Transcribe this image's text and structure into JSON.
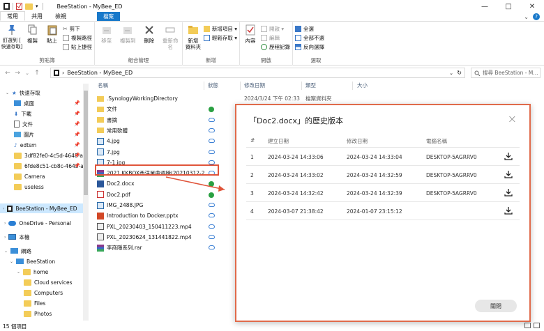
{
  "window": {
    "title": "BeeStation - MyBee_ED",
    "minimize": "—",
    "maximize": "□",
    "close": "✕"
  },
  "ribbon_tabs": [
    "檔案",
    "常用",
    "共用",
    "檢視"
  ],
  "ribbon": {
    "clipboard": {
      "label": "剪貼簿",
      "pin": "釘選到 [\n快速存取]",
      "copy": "複製",
      "paste": "貼上",
      "cut": "剪下",
      "copy_path": "複製路徑",
      "paste_shortcut": "貼上捷徑"
    },
    "organize": {
      "label": "組合管理",
      "move_to": "移至",
      "copy_to": "複製到",
      "delete": "刪除",
      "rename": "重新命名"
    },
    "new": {
      "label": "新增",
      "new_folder": "新增\n資料夾",
      "new_item": "新增項目 ▾",
      "easy_access": "輕鬆存取 ▾"
    },
    "open": {
      "label": "開啟",
      "properties": "內容",
      "open": "開啟 ▾",
      "edit": "編輯",
      "history": "歷程記錄"
    },
    "select": {
      "label": "選取",
      "select_all": "全選",
      "select_none": "全部不選",
      "invert": "反向選擇"
    }
  },
  "address": {
    "path": "BeeStation - MyBee_ED",
    "search_placeholder": "搜尋 BeeStation - M..."
  },
  "nav": {
    "quick_access": "快速存取",
    "items": [
      {
        "label": "桌面",
        "pinned": true
      },
      {
        "label": "下載",
        "pinned": true
      },
      {
        "label": "文件",
        "pinned": true
      },
      {
        "label": "圖片",
        "pinned": true
      },
      {
        "label": "edtsm",
        "pinned": true
      },
      {
        "label": "3df82fe0-4c5d-4648-ac",
        "pinned": true
      },
      {
        "label": "6fde8c51-cb8c-4643-ac",
        "pinned": true
      },
      {
        "label": "Camera",
        "pinned": false
      },
      {
        "label": "useless",
        "pinned": false
      }
    ],
    "beestation_selected": "BeeStation - MyBee_ED",
    "onedrive": "OneDrive - Personal",
    "this_pc": "本機",
    "network": "網路",
    "beestation": "BeeStation",
    "home": "home",
    "sub": [
      "Cloud services",
      "Computers",
      "Files",
      "Photos"
    ]
  },
  "columns": {
    "name": "名稱",
    "status": "狀態",
    "modified": "修改日期",
    "type": "類型",
    "size": "大小"
  },
  "files": [
    {
      "name": ".SynologyWorkingDirectory",
      "icon": "folder-icon",
      "status": "",
      "modified": "2024/3/24 下午 02:33",
      "type": "檔案資料夾"
    },
    {
      "name": "文件",
      "icon": "folder-icon",
      "status": "ok"
    },
    {
      "name": "書摘",
      "icon": "folder-icon",
      "status": "cloud"
    },
    {
      "name": "常用軟體",
      "icon": "folder-icon",
      "status": "cloud"
    },
    {
      "name": "4.jpg",
      "icon": "image-icon",
      "status": "cloud"
    },
    {
      "name": "7.jpg",
      "icon": "image-icon",
      "status": "cloud"
    },
    {
      "name": "7-1.jpg",
      "icon": "image-icon",
      "status": "cloud"
    },
    {
      "name": "2021 KKBOX西洋單曲週榜(20210312-2...",
      "icon": "archive-icon",
      "status": "cloud"
    },
    {
      "name": "Doc2.docx",
      "icon": "word-icon",
      "status": "ok"
    },
    {
      "name": "Doc2.pdf",
      "icon": "pdf-icon",
      "status": "ok"
    },
    {
      "name": "IMG_2488.JPG",
      "icon": "image-icon",
      "status": "cloud"
    },
    {
      "name": "Introduction to Docker.pptx",
      "icon": "ppt-icon",
      "status": "cloud"
    },
    {
      "name": "PXL_20230403_150411223.mp4",
      "icon": "video-icon",
      "status": "cloud"
    },
    {
      "name": "PXL_20230624_131441822.mp4",
      "icon": "video-icon",
      "status": "cloud"
    },
    {
      "name": "李商隱系列.rar",
      "icon": "archive-icon",
      "status": "cloud"
    }
  ],
  "status_bar": "15 個項目",
  "dialog": {
    "title": "「Doc2.docx」的歷史版本",
    "close_x": "×",
    "headers": {
      "num": "#",
      "created": "建立日期",
      "modified": "修改日期",
      "computer": "電腦名稱"
    },
    "rows": [
      {
        "num": "1",
        "created": "2024-03-24 14:33:06",
        "modified": "2024-03-24 14:33:04",
        "computer": "DESKTOP-5AGRRV0"
      },
      {
        "num": "2",
        "created": "2024-03-24 14:33:02",
        "modified": "2024-03-24 14:32:59",
        "computer": "DESKTOP-5AGRRV0"
      },
      {
        "num": "3",
        "created": "2024-03-24 14:32:42",
        "modified": "2024-03-24 14:32:39",
        "computer": "DESKTOP-5AGRRV0"
      },
      {
        "num": "4",
        "created": "2024-03-07 21:38:42",
        "modified": "2024-01-07 23:15:12",
        "computer": ""
      }
    ],
    "close_button": "關閉"
  },
  "colors": {
    "accent": "#1979ca",
    "highlight": "#e0543a",
    "selected_bg": "#cce8ff",
    "synced": "#2aa042",
    "cloud": "#3b7fd4"
  }
}
